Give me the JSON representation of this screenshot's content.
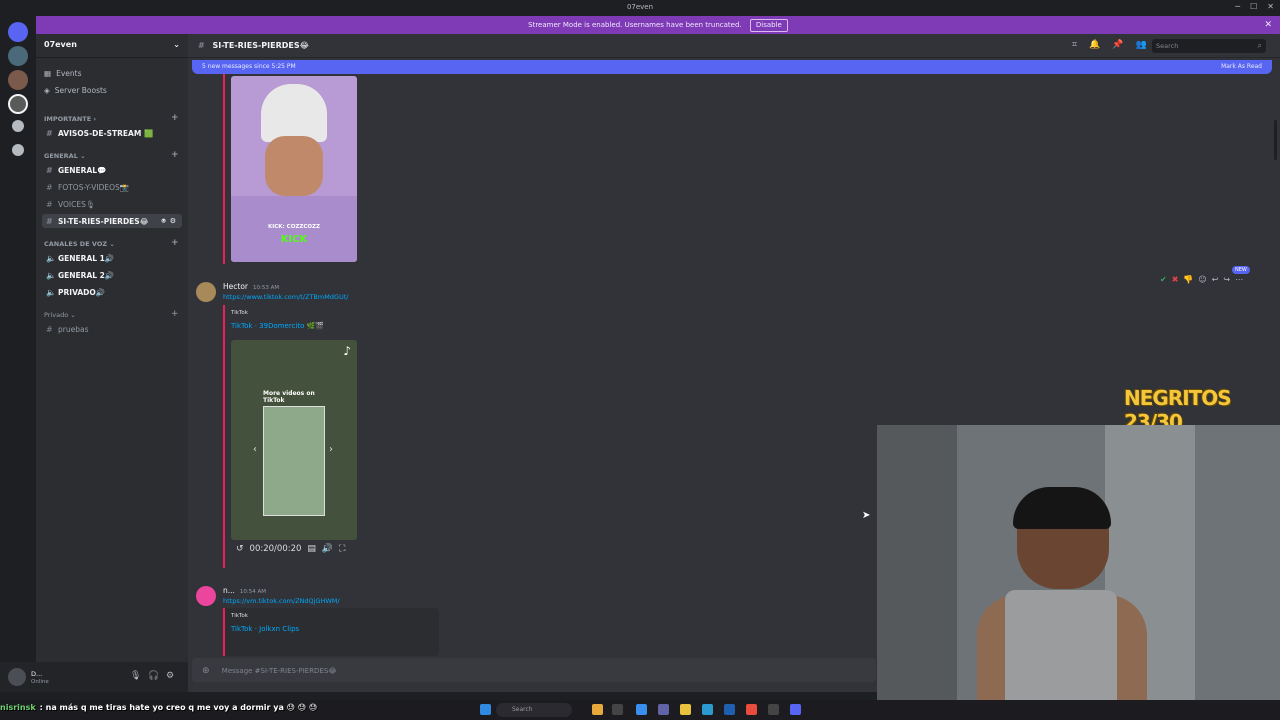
{
  "window": {
    "title": "07even"
  },
  "streamer_banner": {
    "text": "Streamer Mode is enabled. Usernames have been truncated.",
    "button": "Disable"
  },
  "server": {
    "name": "07even",
    "nav": [
      {
        "label": "Events",
        "icon": "calendar-icon"
      },
      {
        "label": "Server Boosts",
        "icon": "boost-icon"
      }
    ],
    "categories": {
      "importante": "IMPORTANTE",
      "general": "GENERAL",
      "voz": "CANALES DE VOZ",
      "privado": "Privado"
    },
    "channels": {
      "avisos": "AVISOS-DE-STREAM 🟩",
      "general": "GENERAL💬",
      "fotos": "FOTOS-Y-VIDEOS📸",
      "voices": "VOICES🎙",
      "si_te_ries": "SI-TE-RIES-PIERDES😂",
      "vgeneral1": "GENERAL 1🔊",
      "vgeneral2": "GENERAL 2🔊",
      "vprivado": "PRIVADO🔊",
      "pruebas": "pruebas"
    }
  },
  "user": {
    "name": "D...",
    "status": "Online"
  },
  "channel_header": {
    "name": "SI-TE-RIES-PIERDES😂",
    "search_placeholder": "Search"
  },
  "new_messages": {
    "text": "5 new messages since 5:25 PM",
    "action": "Mark As Read"
  },
  "messages": [
    {
      "author": "Hector",
      "time": "10:53 AM",
      "link": "https://www.tiktok.com/t/ZTBmMdGUt/",
      "embed_source": "TikTok",
      "embed_title": "TikTok · 39Domercito 🌿🎬",
      "video_text": "More videos on TikTok",
      "video_time": "00:20/00:20",
      "new_tag": "NEW"
    },
    {
      "author": "n...",
      "time": "10:54 AM",
      "link": "https://vm.tiktok.com/ZNdQjGHWM/",
      "embed_source": "TikTok",
      "embed_title": "TikTok · Jolkxn Clips"
    }
  ],
  "top_thumb_text": "KICK: COZZCOZZ",
  "top_thumb_brand": "KICK",
  "composer": {
    "placeholder": "Message #SI-TE-RIES-PIERDES😂"
  },
  "taskbar": {
    "search": "Search"
  },
  "stream_chat": {
    "user": "nisrinsk",
    "text": ": na más q me tiras hate yo creo q me voy a dormir ya 😓 😓 😓"
  },
  "stream_overlay": {
    "text": "NEGRITOS 23/30"
  }
}
